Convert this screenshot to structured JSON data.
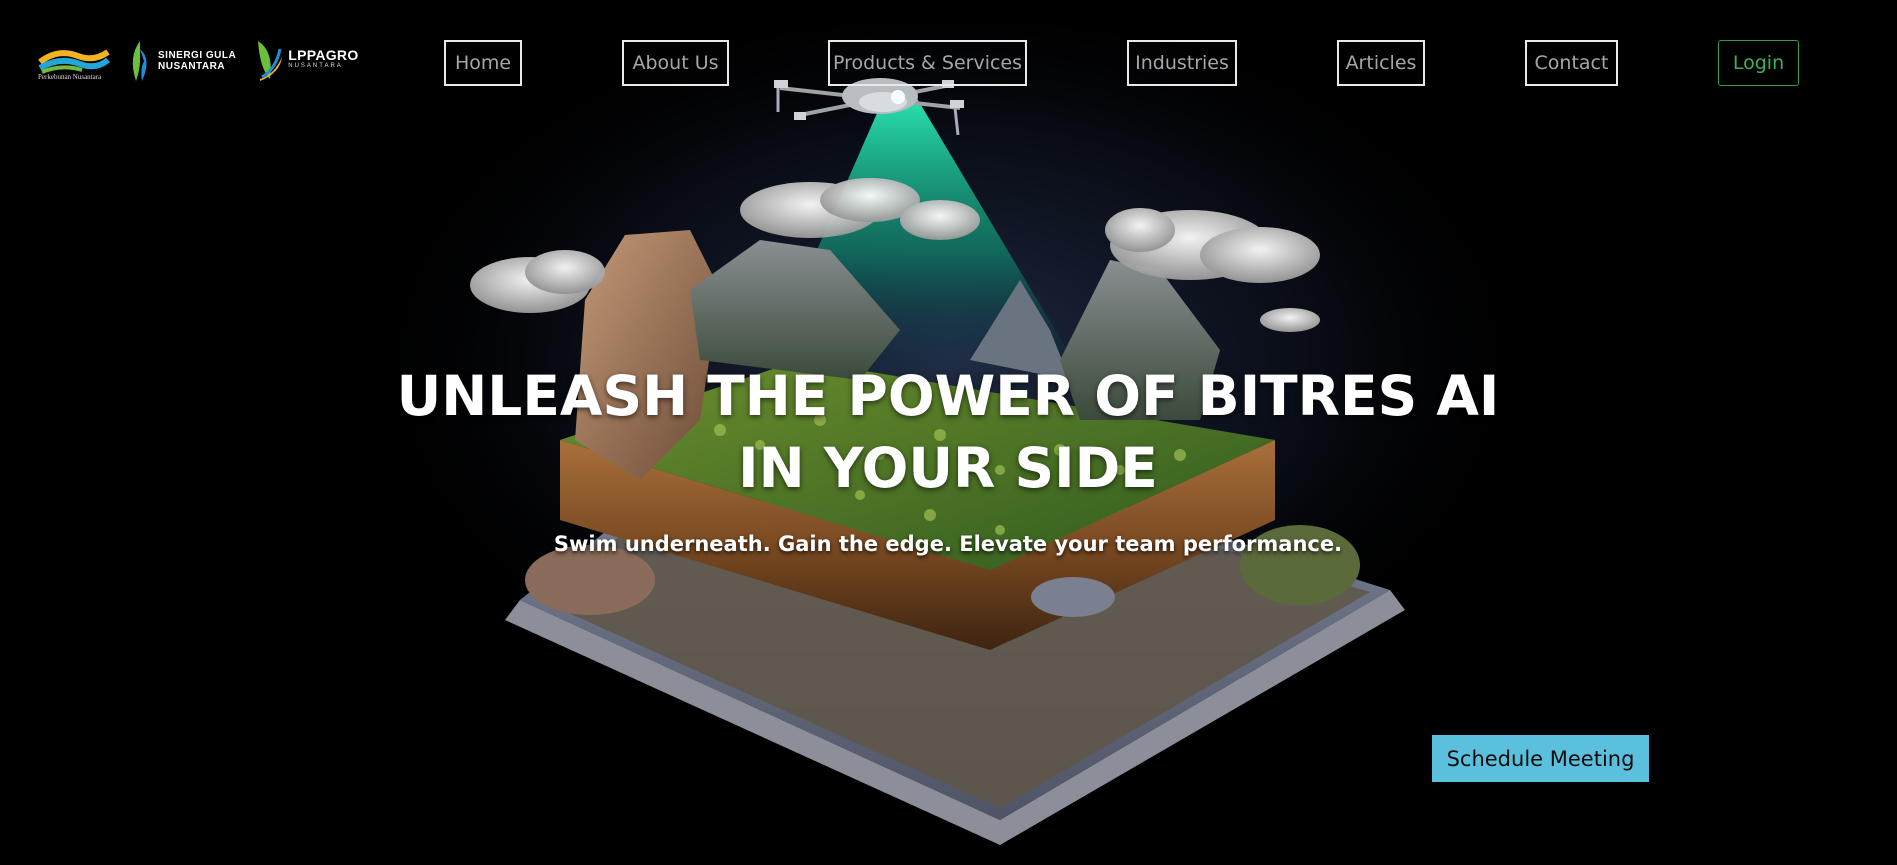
{
  "logos": {
    "logo1_caption": "Perkebunan Nusantara",
    "logo2_line1": "SINERGI GULA",
    "logo2_line2": "NUSANTARA",
    "logo3_line1": "LPPAGRO",
    "logo3_line2": "NUSANTARA"
  },
  "nav": {
    "home": "Home",
    "about": "About Us",
    "products": "Products & Services",
    "industries": "Industries",
    "articles": "Articles",
    "contact": "Contact",
    "login": "Login"
  },
  "hero": {
    "title_line1": "UNLEASH THE POWER OF BITRES AI",
    "title_line2": "IN YOUR SIDE",
    "subtitle": "Swim underneath. Gain the edge. Elevate your team performance.",
    "cta": "Schedule Meeting"
  },
  "colors": {
    "background": "#000000",
    "cta": "#5bc0de",
    "login": "#3db058",
    "nav_border": "#e9e9e9",
    "drone_beam": "#1fd4a0"
  },
  "icons": [
    "drone-icon",
    "logo-ptpn-icon",
    "logo-sgn-icon",
    "logo-lppagro-icon"
  ]
}
